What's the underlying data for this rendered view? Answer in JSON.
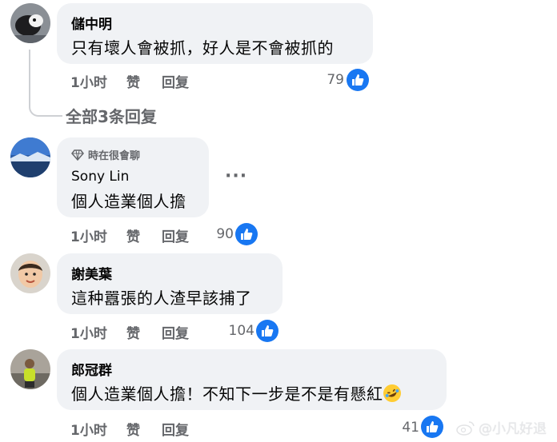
{
  "comments": [
    {
      "name": "儲中明",
      "text": "只有壞人會被抓，好人是不會被抓的",
      "time": "1小时",
      "like_label": "赞",
      "reply_label": "回复",
      "likes": "79"
    },
    {
      "badge": "時在很會聊",
      "name": "Sony Lin",
      "text": "個人造業個人擔",
      "time": "1小时",
      "like_label": "赞",
      "reply_label": "回复",
      "likes": "90"
    },
    {
      "name": "謝美葉",
      "text": "這种囂張的人渣早該捕了",
      "time": "1小时",
      "like_label": "赞",
      "reply_label": "回复",
      "likes": "104"
    },
    {
      "name": "郎冠群",
      "text": "個人造業個人擔！不知下一步是不是有懸紅",
      "time": "1小时",
      "like_label": "赞",
      "reply_label": "回复",
      "likes": "41"
    }
  ],
  "view_all_replies": "全部3条回复",
  "more_label": "···",
  "watermark": "@小凡好退",
  "colors": {
    "like_blue": "#1877f2",
    "bubble": "#f0f2f5",
    "meta_gray": "#65676b"
  }
}
